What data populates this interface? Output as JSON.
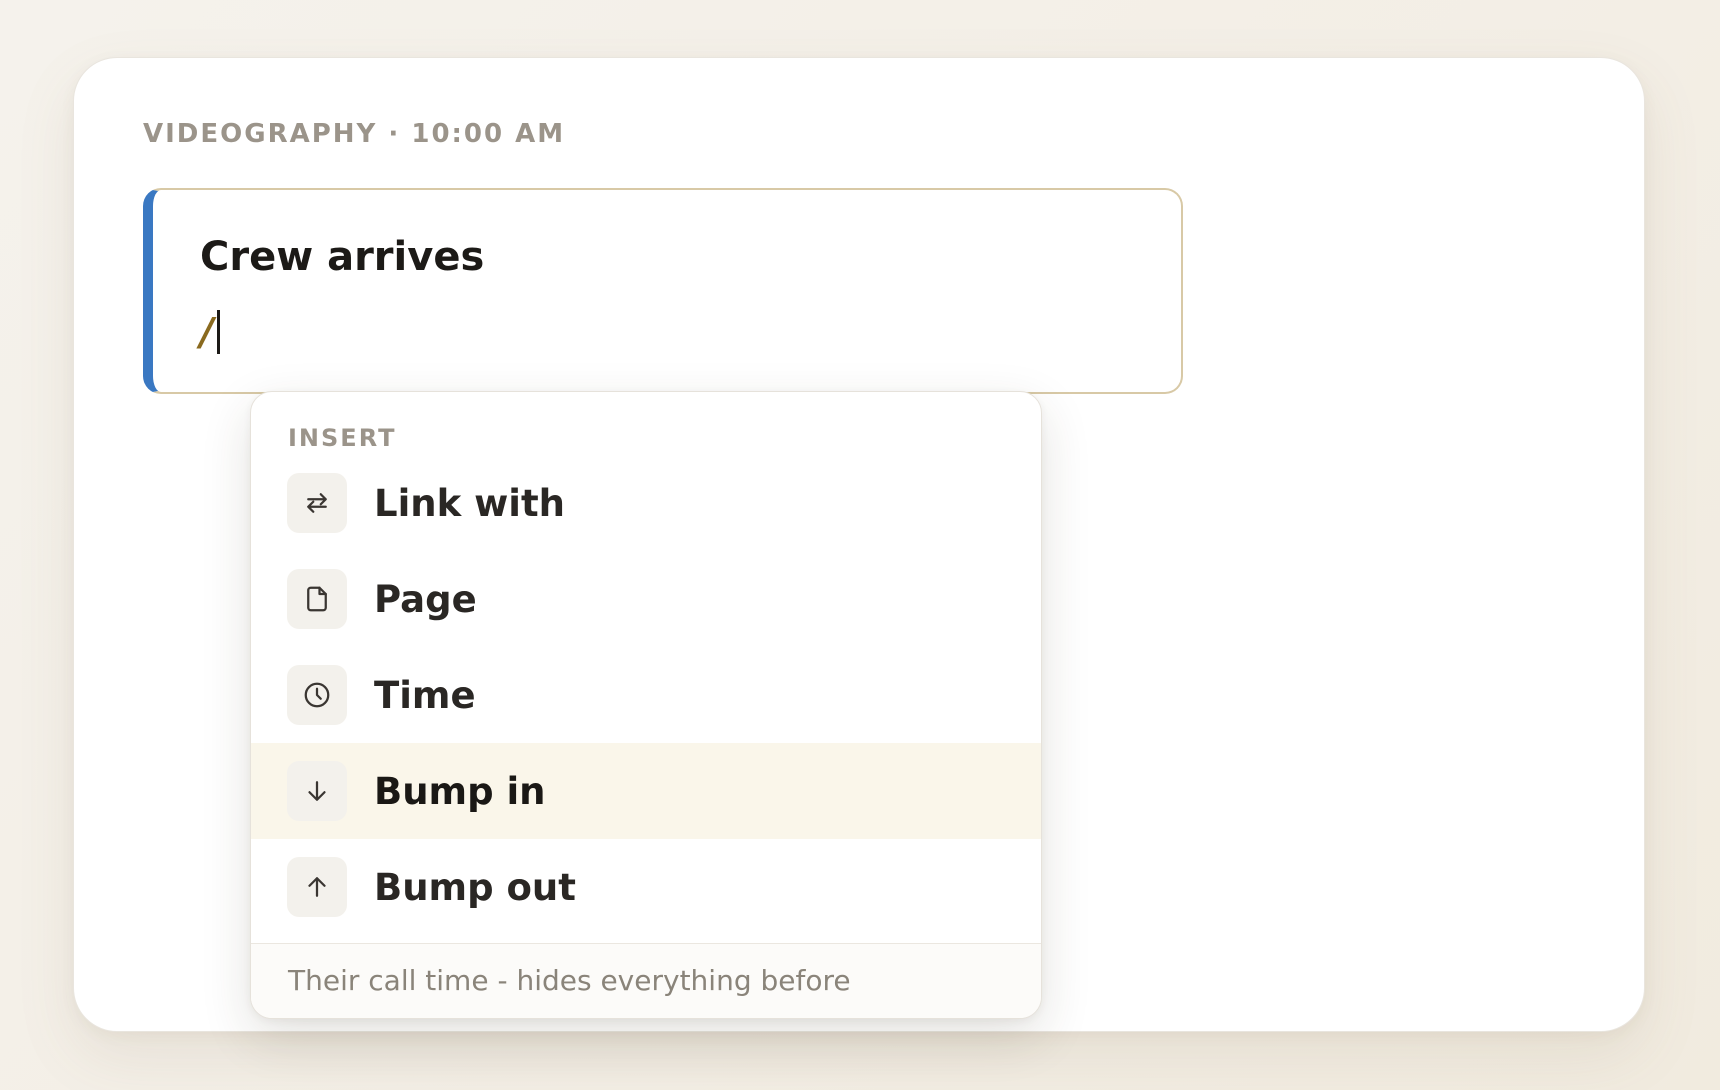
{
  "section": {
    "category": "VIDEOGRAPHY",
    "separator": "·",
    "time": "10:00 AM",
    "label": "VIDEOGRAPHY · 10:00 AM"
  },
  "entry": {
    "title": "Crew arrives",
    "input_value": "/"
  },
  "menu": {
    "header": "INSERT",
    "items": [
      {
        "label": "Link with",
        "icon": "swap-arrows-icon"
      },
      {
        "label": "Page",
        "icon": "page-icon"
      },
      {
        "label": "Time",
        "icon": "clock-icon"
      },
      {
        "label": "Bump in",
        "icon": "arrow-down-icon",
        "highlighted": true
      },
      {
        "label": "Bump out",
        "icon": "arrow-up-icon"
      }
    ],
    "hint": "Their call time - hides everything before"
  },
  "colors": {
    "accent_bar": "#3a78c2",
    "slash": "#8a6a1f",
    "highlight": "#faf6ea",
    "entry_border": "#d8c9a6"
  }
}
